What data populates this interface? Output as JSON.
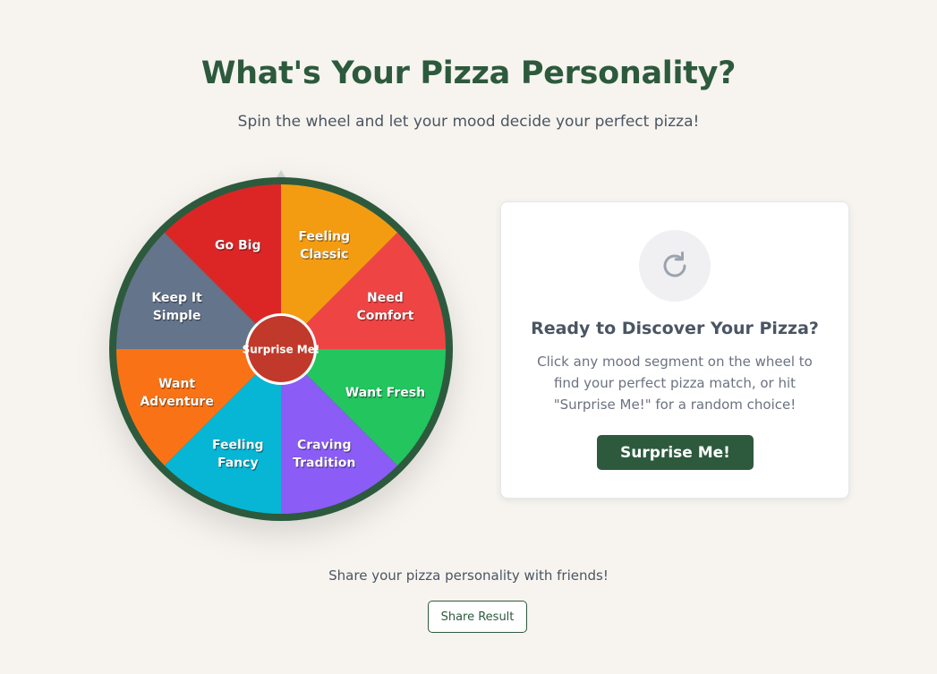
{
  "header": {
    "title": "What's Your Pizza Personality?",
    "subtitle": "Spin the wheel and let your mood decide your perfect pizza!"
  },
  "wheel": {
    "center_label": "Surprise Me!",
    "rim_color": "#2d5a3d",
    "center_color": "#c0392b",
    "segments": [
      {
        "lines": [
          "Feeling",
          "Classic"
        ],
        "color": "#f39c12"
      },
      {
        "lines": [
          "Need",
          "Comfort"
        ],
        "color": "#ef4444"
      },
      {
        "lines": [
          "Want Fresh"
        ],
        "color": "#22c55e"
      },
      {
        "lines": [
          "Craving",
          "Tradition"
        ],
        "color": "#8b5cf6"
      },
      {
        "lines": [
          "Feeling",
          "Fancy"
        ],
        "color": "#06b6d4"
      },
      {
        "lines": [
          "Want",
          "Adventure"
        ],
        "color": "#f97316"
      },
      {
        "lines": [
          "Keep It",
          "Simple"
        ],
        "color": "#64748b"
      },
      {
        "lines": [
          "Go Big"
        ],
        "color": "#dc2626"
      }
    ]
  },
  "result_card": {
    "icon": "refresh-icon",
    "title": "Ready to Discover Your Pizza?",
    "text": "Click any mood segment on the wheel to find your perfect pizza match, or hit \"Surprise Me!\" for a random choice!",
    "button_label": "Surprise Me!"
  },
  "share": {
    "text": "Share your pizza personality with friends!",
    "button_label": "Share Result"
  },
  "colors": {
    "background": "#f7f4ef",
    "brand": "#2d5a3d"
  }
}
